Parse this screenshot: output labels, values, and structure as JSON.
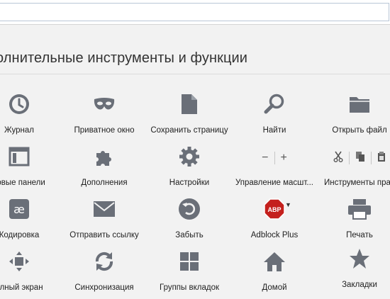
{
  "header": {
    "title": "олнительные инструменты и функции"
  },
  "tools": [
    {
      "label": "Журнал",
      "icon": "clock-icon"
    },
    {
      "label": "Приватное окно",
      "icon": "mask-icon"
    },
    {
      "label": "Сохранить страницу",
      "icon": "page-icon"
    },
    {
      "label": "Найти",
      "icon": "magnifier-icon"
    },
    {
      "label": "Открыть файл",
      "icon": "folder-icon"
    },
    {
      "label": "ковые панели",
      "icon": "sidebar-icon"
    },
    {
      "label": "Дополнения",
      "icon": "puzzle-icon"
    },
    {
      "label": "Настройки",
      "icon": "gear-icon"
    },
    {
      "label": "Управление масшт...",
      "icon": "zoom-controls-icon"
    },
    {
      "label": "Инструменты прав",
      "icon": "edit-controls-icon"
    },
    {
      "label": "Кодировка",
      "icon": "encoding-icon"
    },
    {
      "label": "Отправить ссылку",
      "icon": "envelope-icon"
    },
    {
      "label": "Забыть",
      "icon": "forget-icon"
    },
    {
      "label": "Adblock Plus",
      "icon": "abp-icon",
      "badge": "ABP"
    },
    {
      "label": "Печать",
      "icon": "printer-icon"
    },
    {
      "label": "олный экран",
      "icon": "fullscreen-icon"
    },
    {
      "label": "Синхронизация",
      "icon": "sync-icon"
    },
    {
      "label": "Группы вкладок",
      "icon": "tab-groups-icon"
    },
    {
      "label": "Домой",
      "icon": "home-icon"
    },
    {
      "label": "Закладки",
      "icon": "star-icon"
    }
  ],
  "zoom": {
    "minus": "−",
    "plus": "+"
  },
  "colors": {
    "icon": "#6a6f78",
    "abp": "#c4201d"
  }
}
